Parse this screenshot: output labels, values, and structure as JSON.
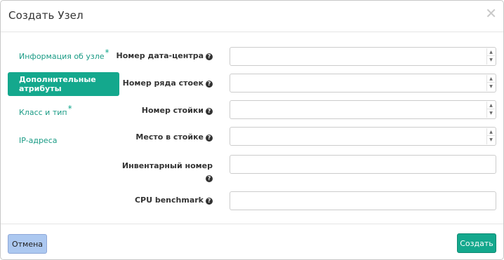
{
  "dialog": {
    "title": "Создать Узел",
    "close_glyph": "✕"
  },
  "sidebar": {
    "items": [
      {
        "label": "Информация об узле",
        "required": true,
        "active": false
      },
      {
        "label": "Дополнительные атрибуты",
        "required": false,
        "active": true
      },
      {
        "label": "Класс и тип",
        "required": true,
        "active": false
      },
      {
        "label": "IP-адреса",
        "required": false,
        "active": false
      }
    ],
    "required_mark": "*"
  },
  "form": {
    "fields": [
      {
        "label": "Номер дата-центра",
        "value": "",
        "type": "number"
      },
      {
        "label": "Номер ряда стоек",
        "value": "",
        "type": "number"
      },
      {
        "label": "Номер стойки",
        "value": "",
        "type": "number"
      },
      {
        "label": "Место в стойке",
        "value": "",
        "type": "number"
      },
      {
        "label": "Инвентарный номер",
        "value": "",
        "type": "text"
      },
      {
        "label": "CPU benchmark",
        "value": "",
        "type": "text"
      }
    ],
    "help_glyph": "?"
  },
  "footer": {
    "cancel_label": "Отмена",
    "create_label": "Создать"
  },
  "colors": {
    "accent": "#14a88d",
    "cancel_bg": "#acc8f0"
  }
}
